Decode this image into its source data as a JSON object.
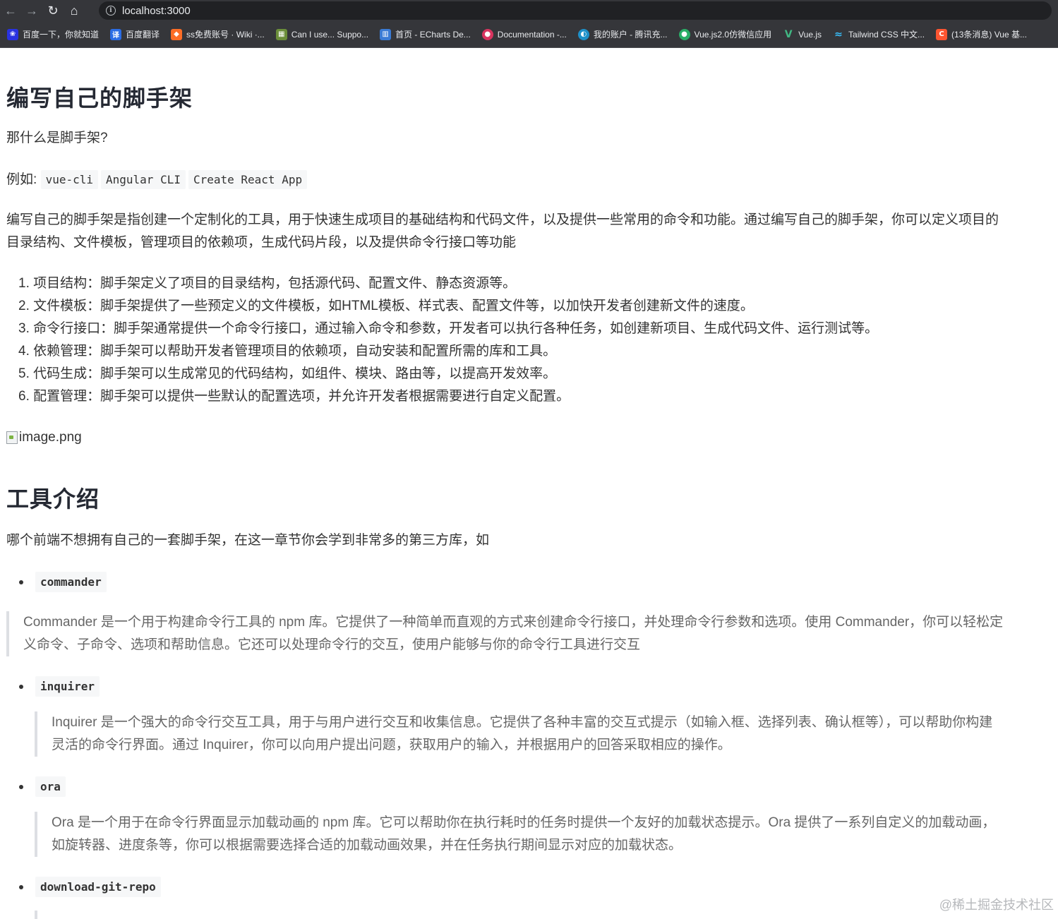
{
  "browser": {
    "url": "localhost:3000",
    "bookmarks": [
      {
        "label": "百度一下，你就知道",
        "icon": "baidu-icon",
        "icon_char": "ஸ",
        "color": "#2932e1"
      },
      {
        "label": "百度翻译",
        "icon": "translate-icon",
        "icon_char": "译",
        "color": "#2b6de5"
      },
      {
        "label": "ss免费账号 · Wiki ·...",
        "icon": "gitlab-icon",
        "icon_char": "◆",
        "color": "#fc6d26"
      },
      {
        "label": "Can I use... Suppo...",
        "icon": "caniuse-icon",
        "icon_char": "▦",
        "color": "#6b8e3a"
      },
      {
        "label": "首页 - ECharts De...",
        "icon": "echarts-icon",
        "icon_char": "▥",
        "color": "#3a7bd5"
      },
      {
        "label": "Documentation -...",
        "icon": "documentation-icon",
        "icon_char": "●",
        "color": "#d8345f"
      },
      {
        "label": "我的账户 - 腾讯充...",
        "icon": "tencent-icon",
        "icon_char": "◐",
        "color": "#1e90c8"
      },
      {
        "label": "Vue.js2.0仿微信应用",
        "icon": "wechat-icon",
        "icon_char": "●",
        "color": "#2aae67"
      },
      {
        "label": "Vue.js",
        "icon": "vue-icon",
        "icon_char": "V",
        "color": "#41b883"
      },
      {
        "label": "Tailwind CSS 中文...",
        "icon": "tailwind-icon",
        "icon_char": "≈",
        "color": "#38bdf8"
      },
      {
        "label": "(13条消息) Vue 基...",
        "icon": "csdn-icon",
        "icon_char": "C",
        "color": "#fc5531"
      }
    ]
  },
  "content": {
    "title": "编写自己的脚手架",
    "question": "那什么是脚手架?",
    "example_label": "例如:",
    "examples": [
      "vue-cli",
      "Angular CLI",
      "Create React App"
    ],
    "intro_line1": "编写自己的脚手架是指创建一个定制化的工具，用于快速生成项目的基础结构和代码文件，以及提供一些常用的命令和功能。通过编写自己的脚手架，你可以定义项目的",
    "intro_line2": "目录结构、文件模板，管理项目的依赖项，生成代码片段，以及提供命令行接口等功能",
    "features": [
      "1. 项目结构：脚手架定义了项目的目录结构，包括源代码、配置文件、静态资源等。",
      "2. 文件模板：脚手架提供了一些预定义的文件模板，如HTML模板、样式表、配置文件等，以加快开发者创建新文件的速度。",
      "3. 命令行接口：脚手架通常提供一个命令行接口，通过输入命令和参数，开发者可以执行各种任务，如创建新项目、生成代码文件、运行测试等。",
      "4. 依赖管理：脚手架可以帮助开发者管理项目的依赖项，自动安装和配置所需的库和工具。",
      "5. 代码生成：脚手架可以生成常见的代码结构，如组件、模块、路由等，以提高开发效率。",
      "6. 配置管理：脚手架可以提供一些默认的配置选项，并允许开发者根据需要进行自定义配置。"
    ],
    "image_alt": "image.png",
    "section_title": "工具介绍",
    "section_intro": "哪个前端不想拥有自己的一套脚手架，在这一章节你会学到非常多的第三方库，如",
    "libraries": [
      {
        "name": "commander",
        "line1": "Commander 是一个用于构建命令行工具的 npm 库。它提供了一种简单而直观的方式来创建命令行接口，并处理命令行参数和选项。使用 Commander，你可以轻松定",
        "line2": "义命令、子命令、选项和帮助信息。它还可以处理命令行的交互，使用户能够与你的命令行工具进行交互"
      },
      {
        "name": "inquirer",
        "line1": "Inquirer 是一个强大的命令行交互工具，用于与用户进行交互和收集信息。它提供了各种丰富的交互式提示（如输入框、选择列表、确认框等），可以帮助你构建",
        "line2": "灵活的命令行界面。通过 Inquirer，你可以向用户提出问题，获取用户的输入，并根据用户的回答采取相应的操作。"
      },
      {
        "name": "ora",
        "line1": "Ora 是一个用于在命令行界面显示加载动画的 npm 库。它可以帮助你在执行耗时的任务时提供一个友好的加载状态提示。Ora 提供了一系列自定义的加载动画，",
        "line2": "如旋转器、进度条等，你可以根据需要选择合适的加载动画效果，并在任务执行期间显示对应的加载状态。"
      },
      {
        "name": "download-git-repo",
        "line1": "",
        "line2": ""
      }
    ],
    "watermark": "@稀土掘金技术社区"
  }
}
